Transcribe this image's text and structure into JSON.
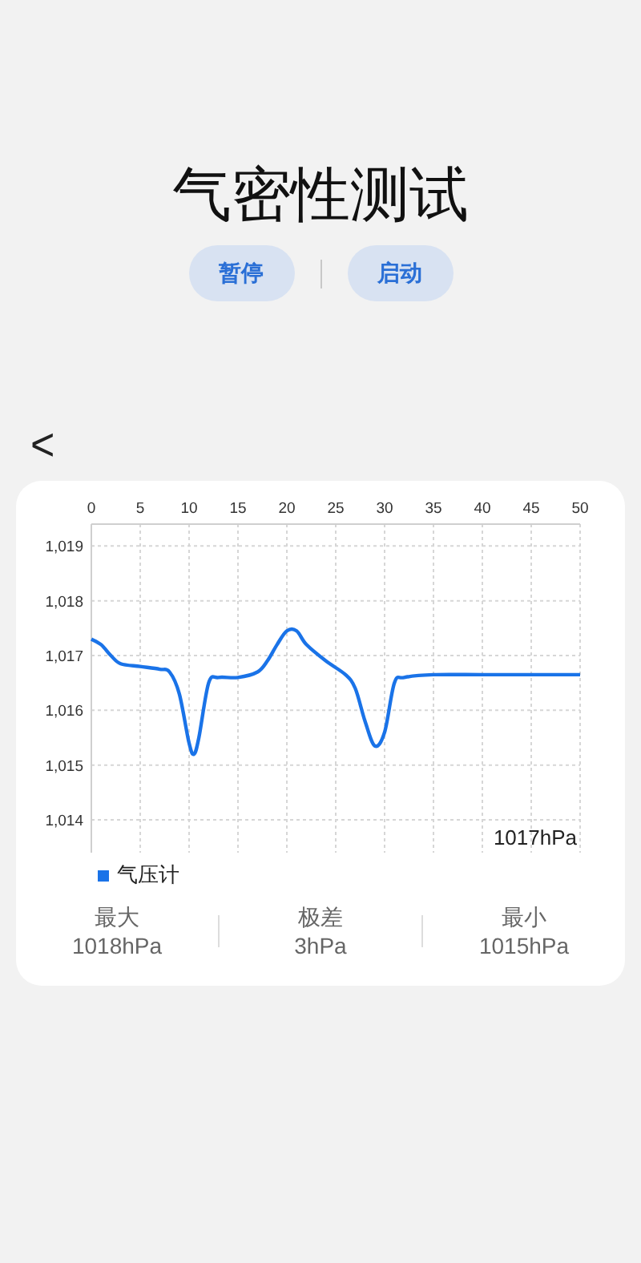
{
  "title": "气密性测试",
  "buttons": [
    {
      "label": "暂停"
    },
    {
      "label": "启动"
    }
  ],
  "back": {
    "label": "<"
  },
  "card": {
    "chart_data": {
      "type": "line",
      "x": [
        0,
        1,
        2,
        3,
        5,
        7,
        8,
        9,
        10,
        10.5,
        11,
        12,
        13,
        15,
        17,
        18,
        19,
        20,
        21,
        22,
        24,
        26,
        27,
        28,
        29,
        30,
        31,
        32,
        35,
        40,
        45,
        50
      ],
      "series": [
        {
          "name": "气压计",
          "color": "#1a73e8",
          "values": [
            1017.3,
            1017.2,
            1017.0,
            1016.85,
            1016.8,
            1016.75,
            1016.7,
            1016.3,
            1015.4,
            1015.2,
            1015.5,
            1016.5,
            1016.6,
            1016.6,
            1016.7,
            1016.9,
            1017.2,
            1017.45,
            1017.45,
            1017.2,
            1016.9,
            1016.65,
            1016.4,
            1015.8,
            1015.35,
            1015.6,
            1016.5,
            1016.6,
            1016.65,
            1016.65,
            1016.65,
            1016.65
          ]
        }
      ],
      "grid": true,
      "xlim": [
        0,
        50
      ],
      "ylim": [
        1013.4,
        1019.4
      ],
      "xticks": [
        0,
        5,
        10,
        15,
        20,
        25,
        30,
        35,
        40,
        45,
        50
      ],
      "yticks": [
        {
          "value": 1014,
          "label": "1,014"
        },
        {
          "value": 1015,
          "label": "1,015"
        },
        {
          "value": 1016,
          "label": "1,016"
        },
        {
          "value": 1017,
          "label": "1,017"
        },
        {
          "value": 1018,
          "label": "1,018"
        },
        {
          "value": 1019,
          "label": "1,019"
        }
      ],
      "annotations": [
        "1017hPa"
      ]
    },
    "stats": [
      {
        "label": "最大",
        "value": "1018hPa"
      },
      {
        "label": "极差",
        "value": "3hPa"
      },
      {
        "label": "最小",
        "value": "1015hPa"
      }
    ]
  }
}
